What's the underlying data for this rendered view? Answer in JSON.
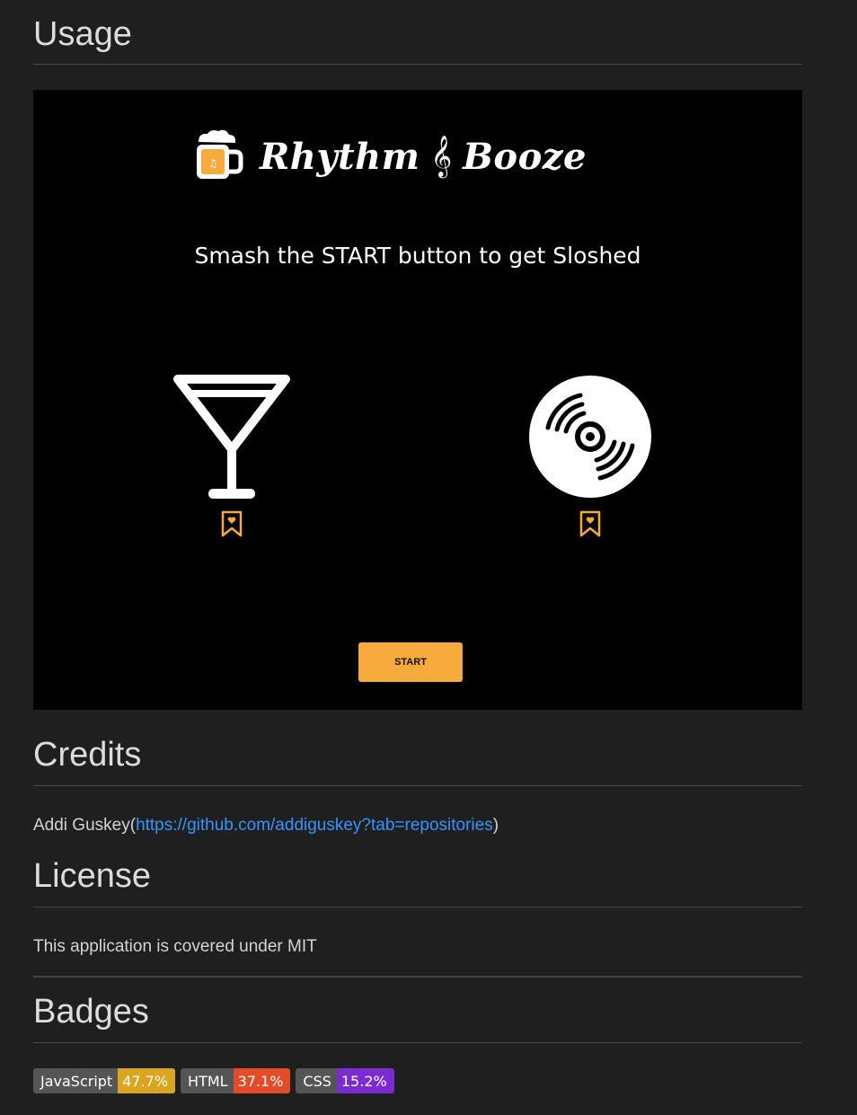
{
  "sections": {
    "usage": {
      "heading": "Usage"
    },
    "credits": {
      "heading": "Credits",
      "author": "Addi Guskey",
      "open_paren": "(",
      "link": "https://github.com/addiguskey?tab=repositories",
      "close_paren": ")"
    },
    "license": {
      "heading": "License",
      "text": "This application is covered under MIT"
    },
    "badges": {
      "heading": "Badges"
    }
  },
  "screenshot": {
    "title_left": "Rhythm",
    "title_right": "Booze",
    "tagline": "Smash the START button to get Sloshed",
    "start_label": "START",
    "icons": [
      "beer-mug-icon",
      "treble-clef-icon",
      "martini-glass-icon",
      "bookmark-heart-icon",
      "vinyl-record-icon"
    ]
  },
  "badges": [
    {
      "key": "JavaScript",
      "value": "47.7%",
      "color": "#dba520"
    },
    {
      "key": "HTML",
      "value": "37.1%",
      "color": "#e34c26"
    },
    {
      "key": "CSS",
      "value": "15.2%",
      "color": "#7b2bd2"
    }
  ],
  "colors": {
    "accent": "#f7ab3c",
    "link": "#3794ff",
    "background": "#1f1f1f"
  }
}
